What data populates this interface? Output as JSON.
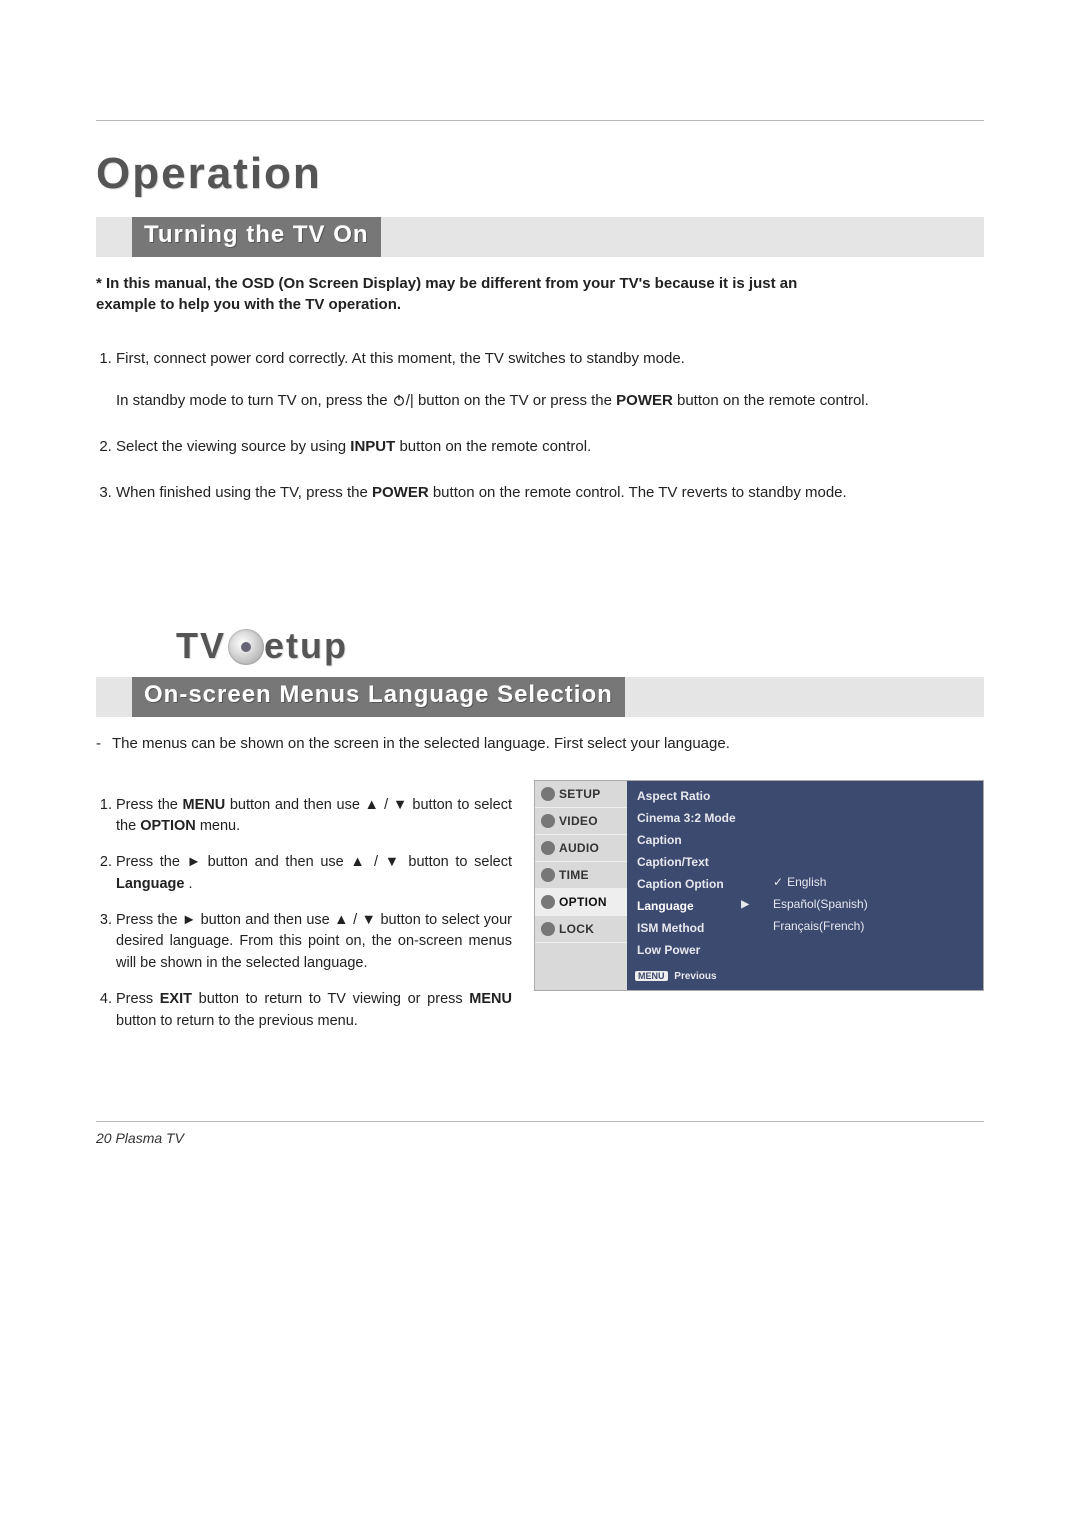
{
  "page_title": "Operation",
  "section1": {
    "heading": "Turning the TV On",
    "note_line1": "* In this manual, the OSD (On Screen Display) may be different from your TV's because it is just an",
    "note_line2": "example to help you with the TV operation.",
    "step1_a": "First, connect power cord correctly. At this moment, the TV switches to standby mode.",
    "step1_b_pre": "In standby mode to turn TV on, press the ",
    "step1_b_post": " button on the TV or press the ",
    "step1_b_bold": "POWER",
    "step1_b_end": " button on the remote control.",
    "step2_pre": "Select the viewing source by using ",
    "step2_bold": "INPUT",
    "step2_post": " button on the remote control.",
    "step3_pre": "When finished using the TV, press the ",
    "step3_bold": "POWER",
    "step3_post": " button on the remote control. The TV reverts to standby mode."
  },
  "section2": {
    "heading": "TV Setup",
    "sub_heading": "On-screen Menus Language Selection",
    "dash_text": "The menus can be shown on the screen in the selected language. First select your language.",
    "s1_a": "Press the ",
    "s1_b": "MENU",
    "s1_c": " button and then use ",
    "s1_d": " button to select the ",
    "s1_e": "OPTION",
    "s1_f": " menu.",
    "s2_a": "Press the ",
    "s2_b": " button and then use ",
    "s2_c": " button to select ",
    "s2_d": "Language",
    "s2_e": ".",
    "s3_a": "Press the ",
    "s3_b": " button and then use ",
    "s3_c": " button to select your desired language. From this point on, the on-screen menus will be shown in the selected language.",
    "s4_a": "Press ",
    "s4_b": "EXIT",
    "s4_c": " button to return to TV viewing or press ",
    "s4_d": "MENU",
    "s4_e": " button to return to the previous menu."
  },
  "glyphs": {
    "up": "▲",
    "down": "▼",
    "right": "►",
    "slash": " / ",
    "power_bar": "|",
    "check": "✓",
    "tri_right": "▶"
  },
  "osd": {
    "tabs": [
      "SETUP",
      "VIDEO",
      "AUDIO",
      "TIME",
      "OPTION",
      "LOCK"
    ],
    "active_tab": "OPTION",
    "mid_items": [
      "Aspect Ratio",
      "Cinema 3:2 Mode",
      "Caption",
      "Caption/Text",
      "Caption Option",
      "Language",
      "ISM Method",
      "Low Power"
    ],
    "selected_mid": "Language",
    "footer_badge": "MENU",
    "footer_text": "Previous",
    "right_items": [
      "English",
      "Español(Spanish)",
      "Français(French)"
    ],
    "right_selected": "English"
  },
  "footer": "20  Plasma TV"
}
